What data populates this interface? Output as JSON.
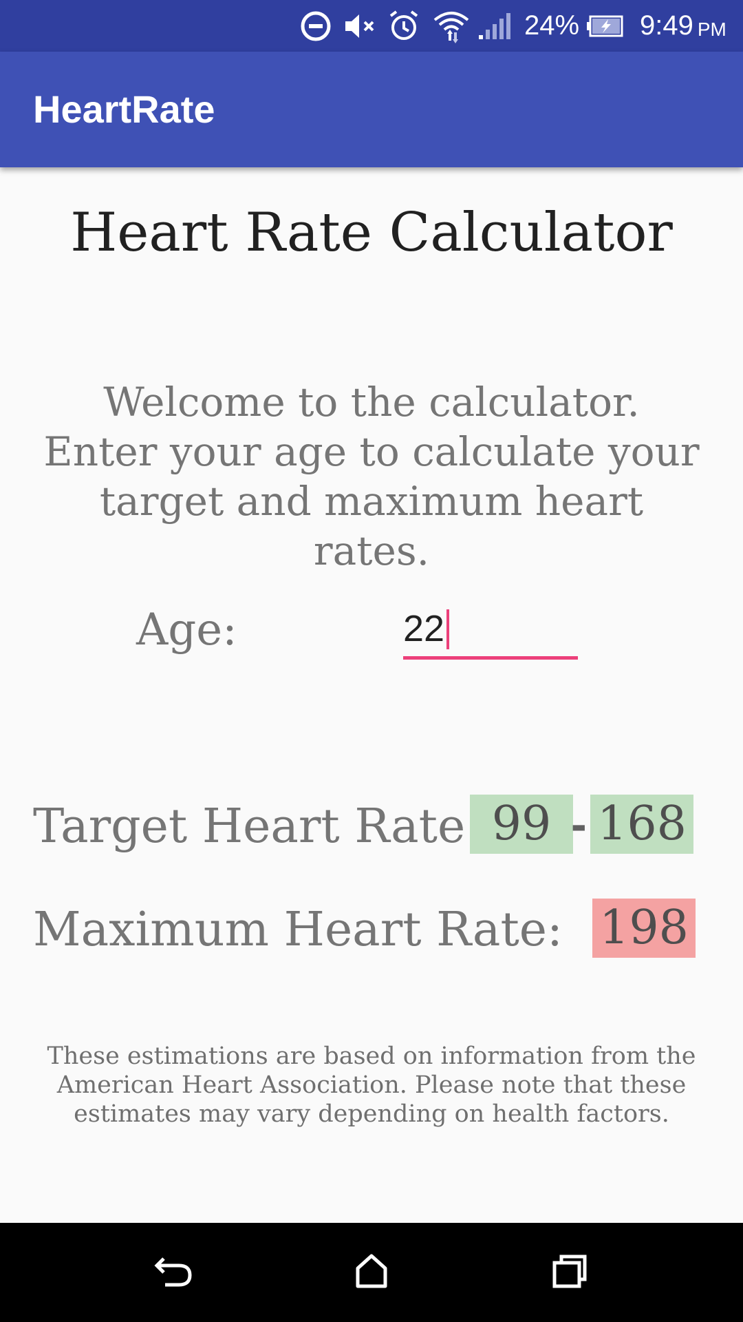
{
  "status_bar": {
    "battery_percent": "24%",
    "time": "9:49",
    "ampm": "PM",
    "icons": [
      "do-not-disturb-icon",
      "mute-icon",
      "alarm-icon",
      "wifi-icon",
      "signal-icon",
      "battery-charging-icon"
    ]
  },
  "app_bar": {
    "title": "HeartRate"
  },
  "main": {
    "heading": "Heart Rate Calculator",
    "welcome": "Welcome to the calculator. Enter your age to calculate your target and maximum heart rates.",
    "age_label": "Age:",
    "age_value": "22",
    "target_label": "Target Heart Rate:",
    "target_low": "99",
    "target_separator": "-",
    "target_high": "168",
    "max_label": "Maximum Heart Rate:",
    "max_value": "198",
    "note": "These estimations are based on information from the American Heart Association. Please note that these estimates may vary depending on health factors."
  },
  "colors": {
    "status_bar": "#303f9f",
    "app_bar": "#3f51b5",
    "accent": "#ec407a",
    "target_box": "#c0dfc0",
    "max_box": "#f4a2a2"
  },
  "nav_bar": {
    "buttons": [
      "back-icon",
      "home-icon",
      "recents-icon"
    ]
  }
}
